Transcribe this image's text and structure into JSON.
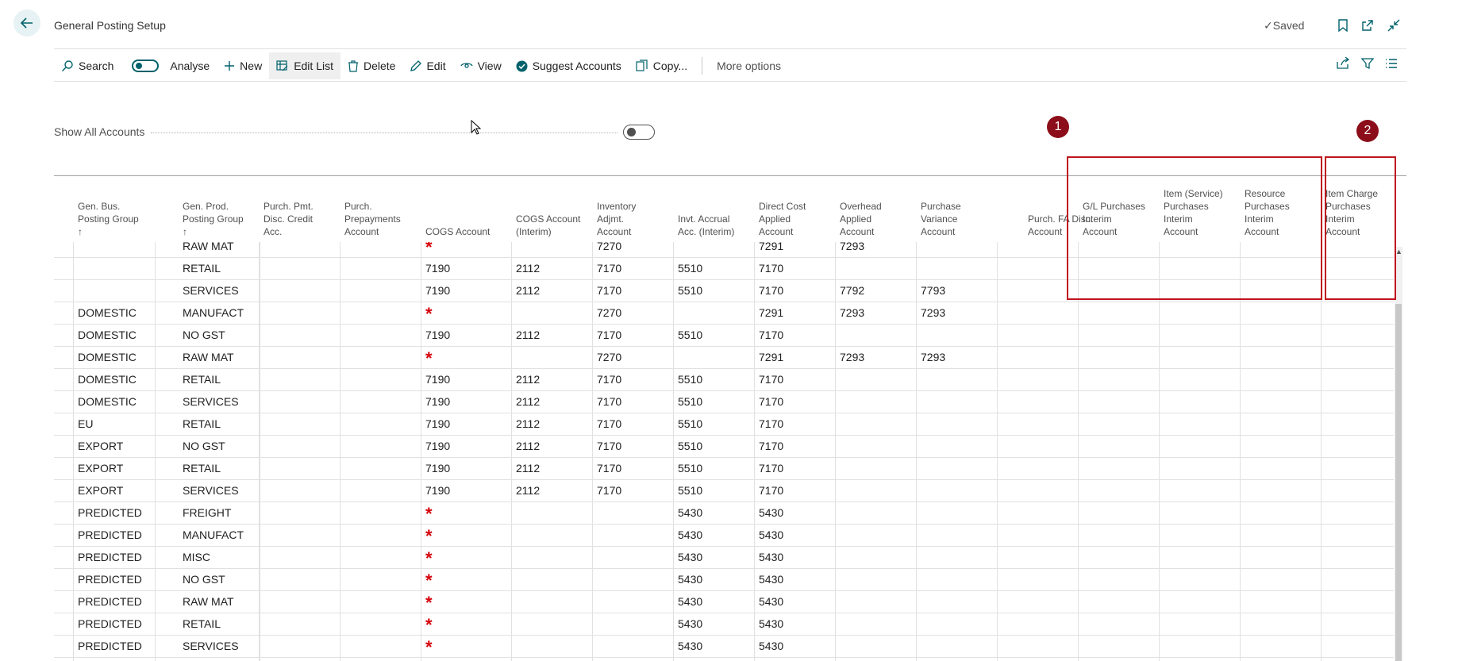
{
  "header": {
    "title": "General Posting Setup",
    "saved_label": "Saved",
    "bookmark_icon": "bookmark-icon",
    "open_new_window_icon": "open-new-window-icon",
    "collapse_icon": "collapse-icon"
  },
  "actions": {
    "search": "Search",
    "analyse": "Analyse",
    "new": "New",
    "edit_list": "Edit List",
    "delete": "Delete",
    "edit": "Edit",
    "view": "View",
    "suggest_accounts": "Suggest Accounts",
    "copy": "Copy...",
    "more_options": "More options"
  },
  "filter": {
    "show_all_accounts_label": "Show All Accounts",
    "show_all_accounts_on": false
  },
  "columns": [
    [
      "Gen. Bus.",
      "Posting Group",
      "↑"
    ],
    [
      "Gen. Prod.",
      "Posting Group",
      "↑"
    ],
    [
      "Purch. Pmt.",
      "Disc. Credit",
      "Acc."
    ],
    [
      "Purch.",
      "Prepayments",
      "Account"
    ],
    [
      "COGS Account"
    ],
    [
      "COGS Account",
      "(Interim)"
    ],
    [
      "Inventory",
      "Adjmt.",
      "Account"
    ],
    [
      "Invt. Accrual",
      "Acc. (Interim)"
    ],
    [
      "Direct Cost",
      "Applied",
      "Account"
    ],
    [
      "Overhead",
      "Applied",
      "Account"
    ],
    [
      "Purchase",
      "Variance",
      "Account"
    ],
    [
      "Purch. FA Disc.",
      "Account"
    ],
    [
      "G/L Purchases",
      "Interim",
      "Account"
    ],
    [
      "Item (Service)",
      "Purchases",
      "Interim",
      "Account"
    ],
    [
      "Resource",
      "Purchases",
      "Interim",
      "Account"
    ],
    [
      "Item Charge",
      "Purchases",
      "Interim",
      "Account"
    ]
  ],
  "rows": [
    {
      "bus": "",
      "prod": "RAW MAT",
      "cogs": "*",
      "cogs_interim": "",
      "inv_adj": "7270",
      "invt_accrual": "",
      "direct_cost": "7291",
      "overhead": "7293",
      "purch_var": ""
    },
    {
      "bus": "",
      "prod": "RETAIL",
      "cogs": "7190",
      "cogs_interim": "2112",
      "inv_adj": "7170",
      "invt_accrual": "5510",
      "direct_cost": "7170",
      "overhead": "",
      "purch_var": ""
    },
    {
      "bus": "",
      "prod": "SERVICES",
      "cogs": "7190",
      "cogs_interim": "2112",
      "inv_adj": "7170",
      "invt_accrual": "5510",
      "direct_cost": "7170",
      "overhead": "7792",
      "purch_var": "7793"
    },
    {
      "bus": "DOMESTIC",
      "prod": "MANUFACT",
      "cogs": "*",
      "cogs_interim": "",
      "inv_adj": "7270",
      "invt_accrual": "",
      "direct_cost": "7291",
      "overhead": "7293",
      "purch_var": "7293"
    },
    {
      "bus": "DOMESTIC",
      "prod": "NO GST",
      "cogs": "7190",
      "cogs_interim": "2112",
      "inv_adj": "7170",
      "invt_accrual": "5510",
      "direct_cost": "7170",
      "overhead": "",
      "purch_var": ""
    },
    {
      "bus": "DOMESTIC",
      "prod": "RAW MAT",
      "cogs": "*",
      "cogs_interim": "",
      "inv_adj": "7270",
      "invt_accrual": "",
      "direct_cost": "7291",
      "overhead": "7293",
      "purch_var": "7293"
    },
    {
      "bus": "DOMESTIC",
      "prod": "RETAIL",
      "cogs": "7190",
      "cogs_interim": "2112",
      "inv_adj": "7170",
      "invt_accrual": "5510",
      "direct_cost": "7170",
      "overhead": "",
      "purch_var": ""
    },
    {
      "bus": "DOMESTIC",
      "prod": "SERVICES",
      "cogs": "7190",
      "cogs_interim": "2112",
      "inv_adj": "7170",
      "invt_accrual": "5510",
      "direct_cost": "7170",
      "overhead": "",
      "purch_var": ""
    },
    {
      "bus": "EU",
      "prod": "RETAIL",
      "cogs": "7190",
      "cogs_interim": "2112",
      "inv_adj": "7170",
      "invt_accrual": "5510",
      "direct_cost": "7170",
      "overhead": "",
      "purch_var": ""
    },
    {
      "bus": "EXPORT",
      "prod": "NO GST",
      "cogs": "7190",
      "cogs_interim": "2112",
      "inv_adj": "7170",
      "invt_accrual": "5510",
      "direct_cost": "7170",
      "overhead": "",
      "purch_var": ""
    },
    {
      "bus": "EXPORT",
      "prod": "RETAIL",
      "cogs": "7190",
      "cogs_interim": "2112",
      "inv_adj": "7170",
      "invt_accrual": "5510",
      "direct_cost": "7170",
      "overhead": "",
      "purch_var": ""
    },
    {
      "bus": "EXPORT",
      "prod": "SERVICES",
      "cogs": "7190",
      "cogs_interim": "2112",
      "inv_adj": "7170",
      "invt_accrual": "5510",
      "direct_cost": "7170",
      "overhead": "",
      "purch_var": ""
    },
    {
      "bus": "PREDICTED",
      "prod": "FREIGHT",
      "cogs": "*",
      "cogs_interim": "",
      "inv_adj": "",
      "invt_accrual": "5430",
      "direct_cost": "5430",
      "overhead": "",
      "purch_var": ""
    },
    {
      "bus": "PREDICTED",
      "prod": "MANUFACT",
      "cogs": "*",
      "cogs_interim": "",
      "inv_adj": "",
      "invt_accrual": "5430",
      "direct_cost": "5430",
      "overhead": "",
      "purch_var": ""
    },
    {
      "bus": "PREDICTED",
      "prod": "MISC",
      "cogs": "*",
      "cogs_interim": "",
      "inv_adj": "",
      "invt_accrual": "5430",
      "direct_cost": "5430",
      "overhead": "",
      "purch_var": ""
    },
    {
      "bus": "PREDICTED",
      "prod": "NO GST",
      "cogs": "*",
      "cogs_interim": "",
      "inv_adj": "",
      "invt_accrual": "5430",
      "direct_cost": "5430",
      "overhead": "",
      "purch_var": ""
    },
    {
      "bus": "PREDICTED",
      "prod": "RAW MAT",
      "cogs": "*",
      "cogs_interim": "",
      "inv_adj": "",
      "invt_accrual": "5430",
      "direct_cost": "5430",
      "overhead": "",
      "purch_var": ""
    },
    {
      "bus": "PREDICTED",
      "prod": "RETAIL",
      "cogs": "*",
      "cogs_interim": "",
      "inv_adj": "",
      "invt_accrual": "5430",
      "direct_cost": "5430",
      "overhead": "",
      "purch_var": ""
    },
    {
      "bus": "PREDICTED",
      "prod": "SERVICES",
      "cogs": "*",
      "cogs_interim": "",
      "inv_adj": "",
      "invt_accrual": "5430",
      "direct_cost": "5430",
      "overhead": "",
      "purch_var": ""
    }
  ],
  "annotations": {
    "badge_1": "1",
    "badge_2": "2",
    "color": "#c0141e"
  },
  "colors": {
    "accent": "#00616b",
    "required_marker": "#d6000b"
  }
}
